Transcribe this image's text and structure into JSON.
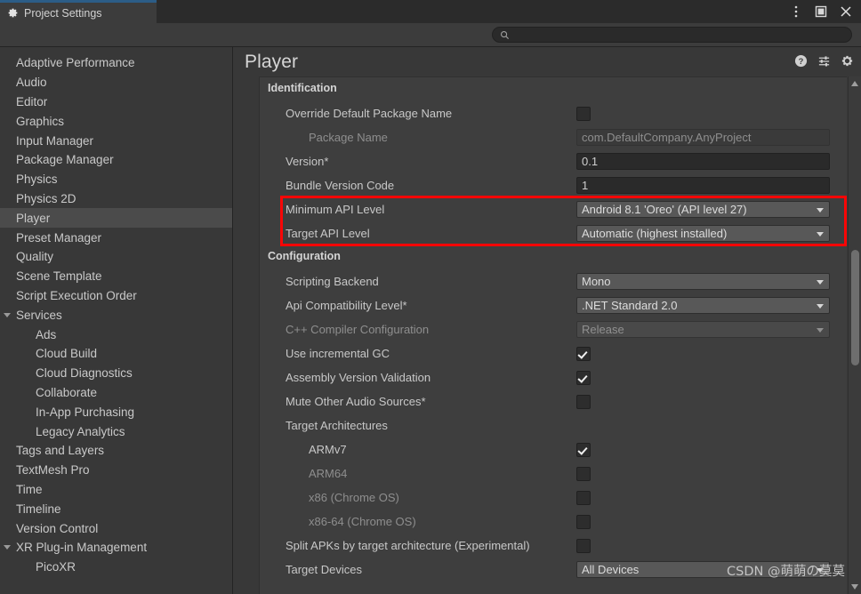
{
  "window": {
    "tab_label": "Project Settings",
    "tab_icon": "gear-icon",
    "accent_color": "#2c5d87",
    "controls": [
      {
        "name": "more-options-icon",
        "glyph": "kebab"
      },
      {
        "name": "maximize-icon",
        "glyph": "square"
      },
      {
        "name": "close-icon",
        "glyph": "x"
      }
    ]
  },
  "search": {
    "icon": "search-icon",
    "value": "",
    "placeholder": ""
  },
  "sidebar": {
    "items": [
      {
        "label": "Adaptive Performance",
        "level": 0,
        "selected": false,
        "expander": "none"
      },
      {
        "label": "Audio",
        "level": 0,
        "selected": false,
        "expander": "none"
      },
      {
        "label": "Editor",
        "level": 0,
        "selected": false,
        "expander": "none"
      },
      {
        "label": "Graphics",
        "level": 0,
        "selected": false,
        "expander": "none"
      },
      {
        "label": "Input Manager",
        "level": 0,
        "selected": false,
        "expander": "none"
      },
      {
        "label": "Package Manager",
        "level": 0,
        "selected": false,
        "expander": "none"
      },
      {
        "label": "Physics",
        "level": 0,
        "selected": false,
        "expander": "none"
      },
      {
        "label": "Physics 2D",
        "level": 0,
        "selected": false,
        "expander": "none"
      },
      {
        "label": "Player",
        "level": 0,
        "selected": true,
        "expander": "none"
      },
      {
        "label": "Preset Manager",
        "level": 0,
        "selected": false,
        "expander": "none"
      },
      {
        "label": "Quality",
        "level": 0,
        "selected": false,
        "expander": "none"
      },
      {
        "label": "Scene Template",
        "level": 0,
        "selected": false,
        "expander": "none"
      },
      {
        "label": "Script Execution Order",
        "level": 0,
        "selected": false,
        "expander": "none"
      },
      {
        "label": "Services",
        "level": 0,
        "selected": false,
        "expander": "open"
      },
      {
        "label": "Ads",
        "level": 1,
        "selected": false,
        "expander": "none"
      },
      {
        "label": "Cloud Build",
        "level": 1,
        "selected": false,
        "expander": "none"
      },
      {
        "label": "Cloud Diagnostics",
        "level": 1,
        "selected": false,
        "expander": "none"
      },
      {
        "label": "Collaborate",
        "level": 1,
        "selected": false,
        "expander": "none"
      },
      {
        "label": "In-App Purchasing",
        "level": 1,
        "selected": false,
        "expander": "none"
      },
      {
        "label": "Legacy Analytics",
        "level": 1,
        "selected": false,
        "expander": "none"
      },
      {
        "label": "Tags and Layers",
        "level": 0,
        "selected": false,
        "expander": "none"
      },
      {
        "label": "TextMesh Pro",
        "level": 0,
        "selected": false,
        "expander": "none"
      },
      {
        "label": "Time",
        "level": 0,
        "selected": false,
        "expander": "none"
      },
      {
        "label": "Timeline",
        "level": 0,
        "selected": false,
        "expander": "none"
      },
      {
        "label": "Version Control",
        "level": 0,
        "selected": false,
        "expander": "none"
      },
      {
        "label": "XR Plug-in Management",
        "level": 0,
        "selected": false,
        "expander": "open"
      },
      {
        "label": "PicoXR",
        "level": 1,
        "selected": false,
        "expander": "none"
      }
    ]
  },
  "panel": {
    "title": "Player",
    "header_icons": [
      {
        "name": "help-icon"
      },
      {
        "name": "preset-icon"
      },
      {
        "name": "settings-gear-icon"
      }
    ],
    "sections": [
      {
        "title": "Identification",
        "rows": [
          {
            "label": "Override Default Package Name",
            "indent": false,
            "dim": false,
            "control": "checkbox",
            "checked": false
          },
          {
            "label": "Package Name",
            "indent": true,
            "dim": true,
            "control": "text",
            "value": "com.DefaultCompany.AnyProject",
            "disabled": true
          },
          {
            "label": "Version*",
            "indent": false,
            "dim": false,
            "control": "text",
            "value": "0.1",
            "disabled": false
          },
          {
            "label": "Bundle Version Code",
            "indent": false,
            "dim": false,
            "control": "text",
            "value": "1",
            "disabled": false
          },
          {
            "label": "Minimum API Level",
            "indent": false,
            "dim": false,
            "control": "dropdown",
            "value": "Android 8.1 'Oreo' (API level 27)",
            "disabled": false,
            "highlighted": true
          },
          {
            "label": "Target API Level",
            "indent": false,
            "dim": false,
            "control": "dropdown",
            "value": "Automatic (highest installed)",
            "disabled": false,
            "highlighted": true
          }
        ]
      },
      {
        "title": "Configuration",
        "rows": [
          {
            "label": "Scripting Backend",
            "indent": false,
            "dim": false,
            "control": "dropdown",
            "value": "Mono",
            "disabled": false
          },
          {
            "label": "Api Compatibility Level*",
            "indent": false,
            "dim": false,
            "control": "dropdown",
            "value": ".NET Standard 2.0",
            "disabled": false
          },
          {
            "label": "C++ Compiler Configuration",
            "indent": false,
            "dim": true,
            "control": "dropdown",
            "value": "Release",
            "disabled": true
          },
          {
            "label": "Use incremental GC",
            "indent": false,
            "dim": false,
            "control": "checkbox",
            "checked": true
          },
          {
            "label": "Assembly Version Validation",
            "indent": false,
            "dim": false,
            "control": "checkbox",
            "checked": true
          },
          {
            "label": "Mute Other Audio Sources*",
            "indent": false,
            "dim": false,
            "control": "checkbox",
            "checked": false
          },
          {
            "label": "Target Architectures",
            "indent": false,
            "dim": false,
            "control": "none"
          },
          {
            "label": "ARMv7",
            "indent": true,
            "dim": false,
            "control": "checkbox",
            "checked": true
          },
          {
            "label": "ARM64",
            "indent": true,
            "dim": true,
            "control": "checkbox",
            "checked": false
          },
          {
            "label": "x86 (Chrome OS)",
            "indent": true,
            "dim": true,
            "control": "checkbox",
            "checked": false
          },
          {
            "label": "x86-64 (Chrome OS)",
            "indent": true,
            "dim": true,
            "control": "checkbox",
            "checked": false
          },
          {
            "label": "Split APKs by target architecture (Experimental)",
            "indent": false,
            "dim": false,
            "control": "checkbox",
            "checked": false,
            "clip": true
          },
          {
            "label": "Target Devices",
            "indent": false,
            "dim": false,
            "control": "dropdown",
            "value": "All Devices",
            "disabled": false
          }
        ]
      }
    ]
  },
  "highlight": {
    "color": "#fb0606"
  },
  "watermark": {
    "text": "CSDN @萌萌の莫莫"
  }
}
